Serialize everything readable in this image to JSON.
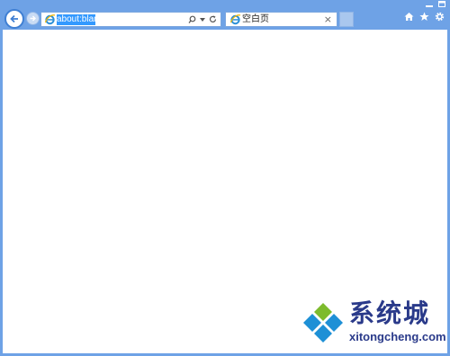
{
  "address_bar": {
    "url": "about:blank"
  },
  "tab": {
    "title": "空白页",
    "close_glyph": "×"
  },
  "caption": {
    "minimize_icon": "minimize-icon",
    "restore_icon": "restore-icon"
  },
  "icons": {
    "back": "back-arrow-icon",
    "forward": "forward-arrow-icon",
    "search": "search-icon",
    "refresh": "refresh-icon",
    "home": "home-icon",
    "favorites": "star-icon",
    "tools": "gear-icon"
  },
  "watermark": {
    "brand": "系统城",
    "url": "xitongcheng.com"
  },
  "colors": {
    "frame": "#6ea2e6",
    "accent": "#3f7fd3",
    "selection": "#3399ff",
    "watermark_text": "#2a3a8a",
    "logo_blue": "#1e90d6",
    "logo_green": "#7dbb2d"
  }
}
